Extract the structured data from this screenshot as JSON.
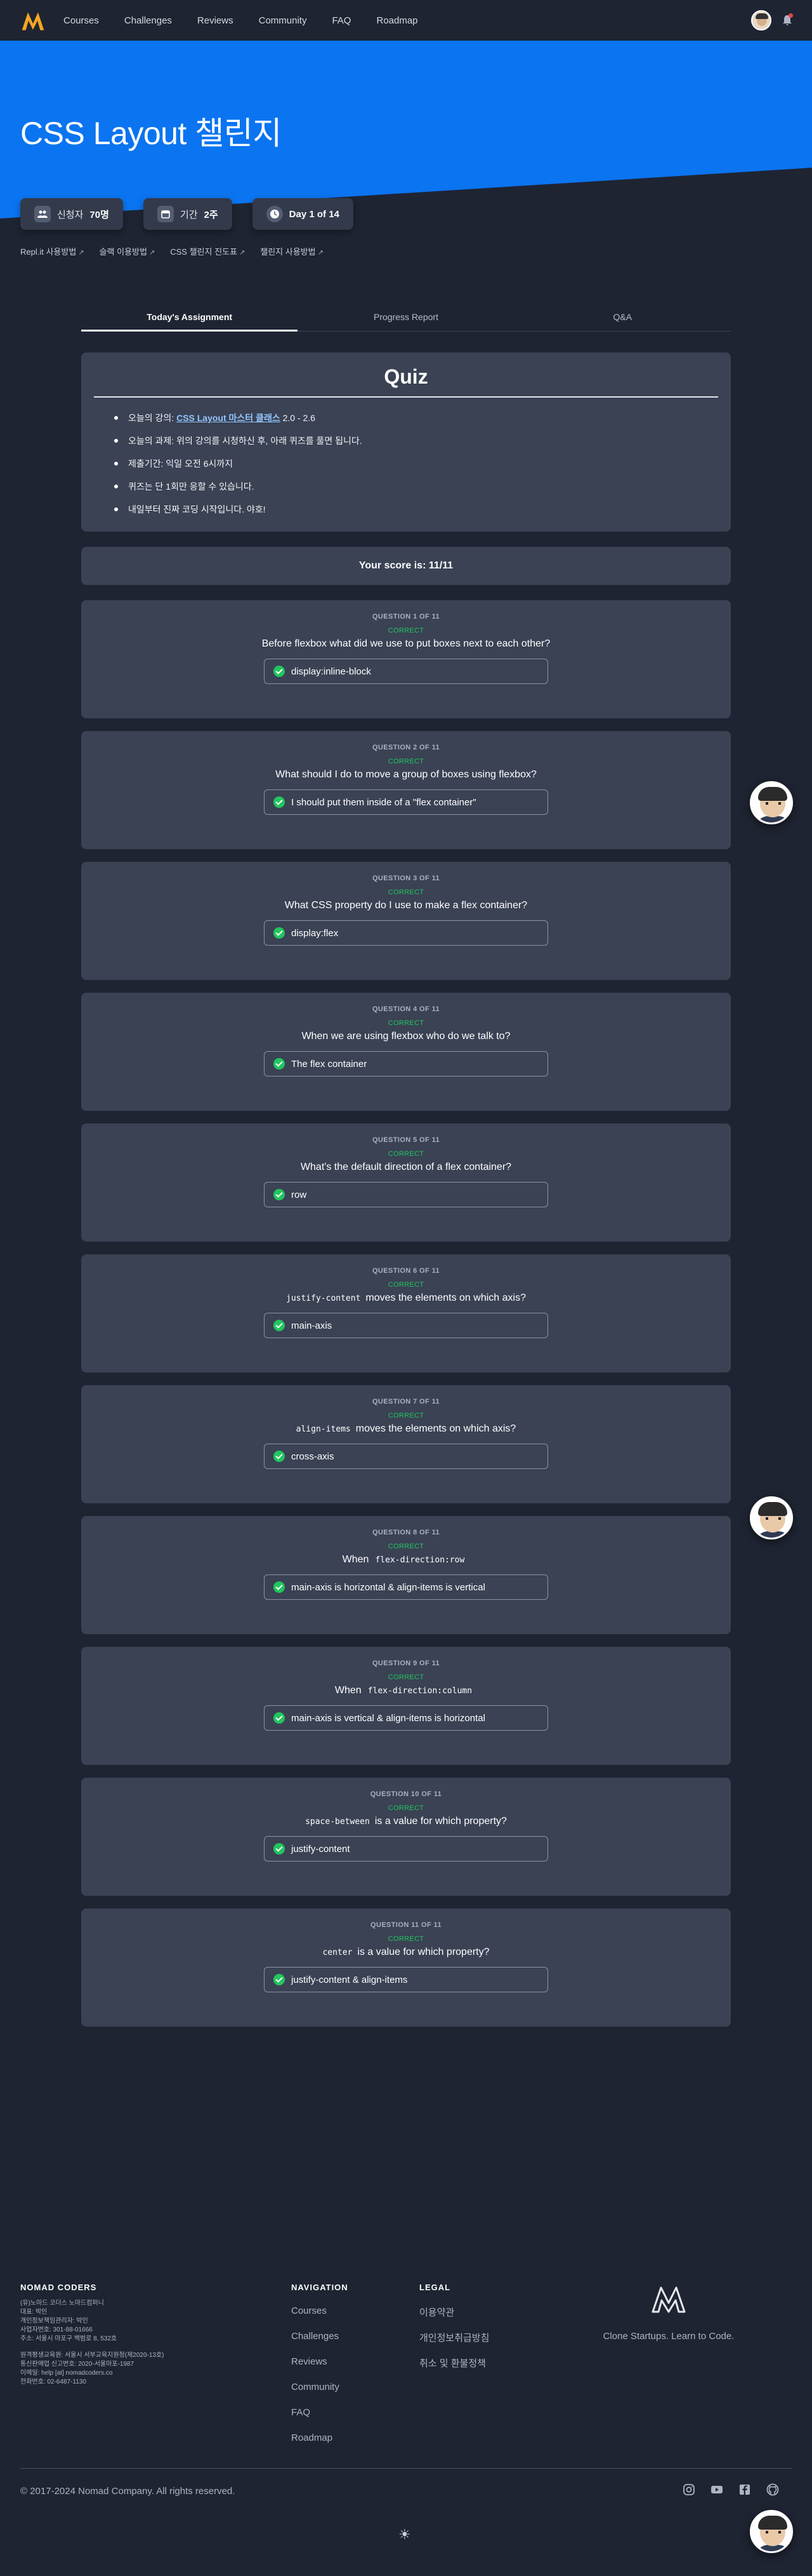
{
  "nav": {
    "items": [
      "Courses",
      "Challenges",
      "Reviews",
      "Community",
      "FAQ",
      "Roadmap"
    ]
  },
  "hero": {
    "title": "CSS Layout 챌린지",
    "stats": [
      {
        "label": "신청자",
        "value": "70명",
        "icon": "users-icon"
      },
      {
        "label": "기간",
        "value": "2주",
        "icon": "calendar-icon"
      },
      {
        "label": "",
        "value": "Day 1 of 14",
        "icon": "clock-icon"
      }
    ],
    "links": [
      "Repl.it 사용방법",
      "슬랙 이용방법",
      "CSS 챌린지 진도표",
      "챌린지 사용방법"
    ]
  },
  "tabs": [
    "Today's Assignment",
    "Progress Report",
    "Q&A"
  ],
  "quiz": {
    "title": "Quiz",
    "items": [
      {
        "prefix": "오늘의 강의: ",
        "link": "CSS Layout 마스터 클래스",
        "suffix": " 2.0 - 2.6"
      },
      {
        "prefix": "오늘의 과제: 위의 강의를 시청하신 후, 아래 퀴즈를 풀면 됩니다.",
        "link": "",
        "suffix": ""
      },
      {
        "prefix": "제출기간: 익일 오전 6시까지",
        "link": "",
        "suffix": ""
      },
      {
        "prefix": "퀴즈는 단 1회만 응할 수 있습니다.",
        "link": "",
        "suffix": ""
      },
      {
        "prefix": "내일부터 진짜 코딩 시작입니다. 야호!",
        "link": "",
        "suffix": ""
      }
    ]
  },
  "score": "Your score is: 11/11",
  "status_label": "CORRECT",
  "questions": [
    {
      "head": "QUESTION 1 OF 11",
      "code": "",
      "text": "Before flexbox what did we use to put boxes next to each other?",
      "answer": "display:inline-block"
    },
    {
      "head": "QUESTION 2 OF 11",
      "code": "",
      "text": "What should I do to move a group of boxes using flexbox?",
      "answer": "I should put them inside of a \"flex container\""
    },
    {
      "head": "QUESTION 3 OF 11",
      "code": "",
      "text": "What CSS property do I use to make a flex container?",
      "answer": "display:flex"
    },
    {
      "head": "QUESTION 4 OF 11",
      "code": "",
      "text": "When we are using flexbox who do we talk to?",
      "answer": "The flex container"
    },
    {
      "head": "QUESTION 5 OF 11",
      "code": "",
      "text": "What's the default direction of a flex container?",
      "answer": "row"
    },
    {
      "head": "QUESTION 6 OF 11",
      "code": "justify-content",
      "text": "moves the elements on which axis?",
      "answer": "main-axis"
    },
    {
      "head": "QUESTION 7 OF 11",
      "code": "align-items",
      "text": "moves the elements on which axis?",
      "answer": "cross-axis"
    },
    {
      "head": "QUESTION 8 OF 11",
      "pre": "When",
      "code": "flex-direction:row",
      "text": "",
      "answer": "main-axis is horizontal & align-items is vertical"
    },
    {
      "head": "QUESTION 9 OF 11",
      "pre": "When",
      "code": "flex-direction:column",
      "text": "",
      "answer": "main-axis is vertical & align-items is horizontal"
    },
    {
      "head": "QUESTION 10 OF 11",
      "code": "space-between",
      "text": "is a value for which property?",
      "answer": "justify-content"
    },
    {
      "head": "QUESTION 11 OF 11",
      "code": "center",
      "text": "is a value for which property?",
      "answer": "justify-content & align-items"
    }
  ],
  "footer": {
    "brand": "NOMAD CODERS",
    "company_lines": [
      "(유)노마드 코더스 노마드컴퍼니",
      "대표: 박인",
      "개인정보책임관리자: 박인",
      "사업자번호: 301-88-01666",
      "주소: 서울시 마포구 백범로 8, 532호",
      "",
      "원격평생교육원: 서울시 서부교육지원청(제2020-13호)",
      "통신판매업 신고번호: 2020-서울마포-1987",
      "이메일: help [at] nomadcoders.co",
      "전화번호: 02-6487-1130"
    ],
    "navigation_title": "NAVIGATION",
    "navigation": [
      "Courses",
      "Challenges",
      "Reviews",
      "Community",
      "FAQ",
      "Roadmap"
    ],
    "legal_title": "LEGAL",
    "legal": [
      "이용약관",
      "개인정보취급방침",
      "취소 및 환불정책"
    ],
    "tagline": "Clone Startups. Learn to Code.",
    "copyright": "© 2017-2024 Nomad Company. All rights reserved.",
    "social": [
      "instagram-icon",
      "youtube-icon",
      "facebook-icon",
      "github-icon"
    ]
  },
  "colors": {
    "hero_blue": "#0b74f0",
    "background": "#1e2432",
    "panel": "#3a4254",
    "correct": "#22c55e",
    "logo_gold": "#f5a623"
  }
}
